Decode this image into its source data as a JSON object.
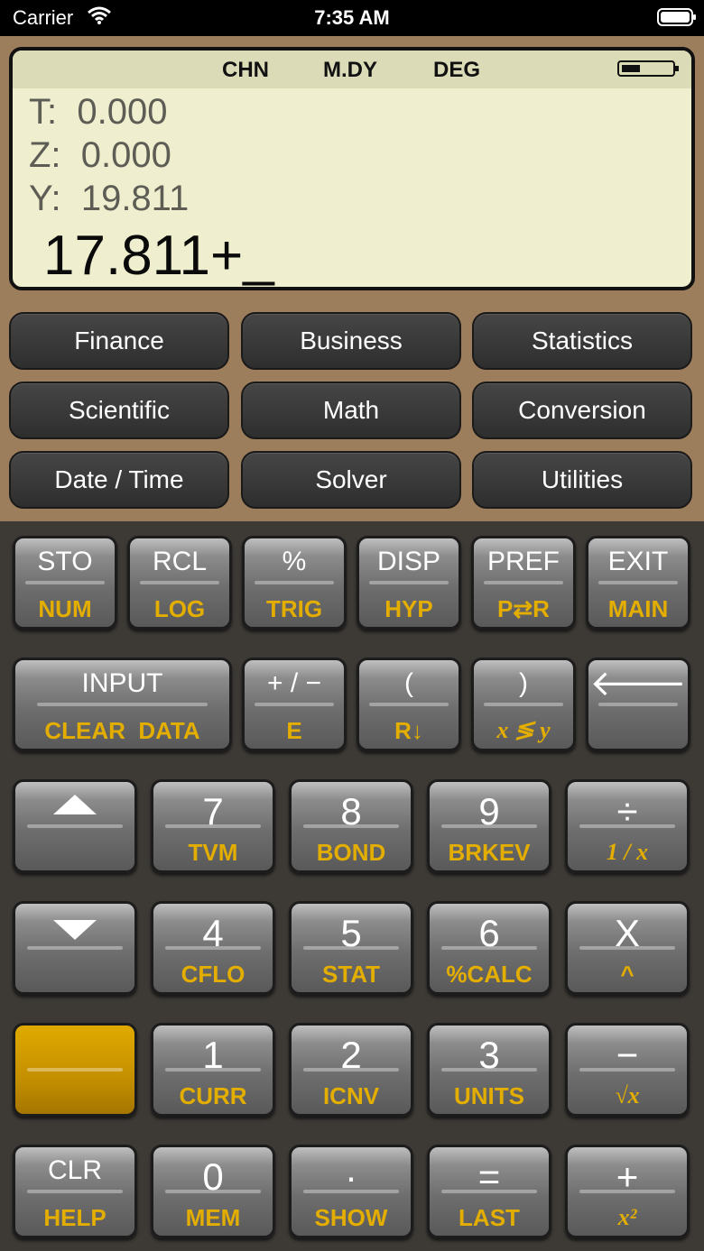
{
  "status_bar": {
    "carrier": "Carrier",
    "time": "7:35 AM"
  },
  "display": {
    "indicators": [
      "CHN",
      "M.DY",
      "DEG"
    ],
    "t_label": "T:",
    "t_value": "0.000",
    "z_label": "Z:",
    "z_value": "0.000",
    "y_label": "Y:",
    "y_value": "19.811",
    "entry": "17.811+_"
  },
  "menus": [
    "Finance",
    "Business",
    "Statistics",
    "Scientific",
    "Math",
    "Conversion",
    "Date / Time",
    "Solver",
    "Utilities"
  ],
  "keys": {
    "sto": {
      "main": "STO",
      "sub": "NUM"
    },
    "rcl": {
      "main": "RCL",
      "sub": "LOG"
    },
    "pct": {
      "main": "%",
      "sub": "TRIG"
    },
    "disp": {
      "main": "DISP",
      "sub": "HYP"
    },
    "pref": {
      "main": "PREF",
      "sub": "P⇄R"
    },
    "exit": {
      "main": "EXIT",
      "sub": "MAIN"
    },
    "input": {
      "main": "INPUT",
      "sub": "CLEAR  DATA"
    },
    "sign": {
      "main": "+ / −",
      "sub": "E"
    },
    "lparen": {
      "main": "(",
      "sub": "R↓"
    },
    "rparen": {
      "main": ")",
      "sub": "x ≶ y"
    },
    "back": {
      "main": "🡐"
    },
    "k7": {
      "main": "7",
      "sub": "TVM"
    },
    "k8": {
      "main": "8",
      "sub": "BOND"
    },
    "k9": {
      "main": "9",
      "sub": "BRKEV"
    },
    "div": {
      "main": "÷",
      "sub": "1 / x"
    },
    "k4": {
      "main": "4",
      "sub": "CFLO"
    },
    "k5": {
      "main": "5",
      "sub": "STAT"
    },
    "k6": {
      "main": "6",
      "sub": "%CALC"
    },
    "mul": {
      "main": "X",
      "sub": "^"
    },
    "k1": {
      "main": "1",
      "sub": "CURR"
    },
    "k2": {
      "main": "2",
      "sub": "ICNV"
    },
    "k3": {
      "main": "3",
      "sub": "UNITS"
    },
    "sub_key": {
      "main": "−",
      "sub": "√x"
    },
    "clr": {
      "main": "CLR",
      "sub": "HELP"
    },
    "k0": {
      "main": "0",
      "sub": "MEM"
    },
    "dot": {
      "main": "·",
      "sub": "SHOW"
    },
    "eq": {
      "main": "=",
      "sub": "LAST"
    },
    "add": {
      "main": "+",
      "sub": "x²"
    }
  },
  "colors": {
    "lcd": "#efefcf",
    "panel": "#9c7d5c",
    "shift": "#e3ae00",
    "keypad": "#3d3a36"
  }
}
